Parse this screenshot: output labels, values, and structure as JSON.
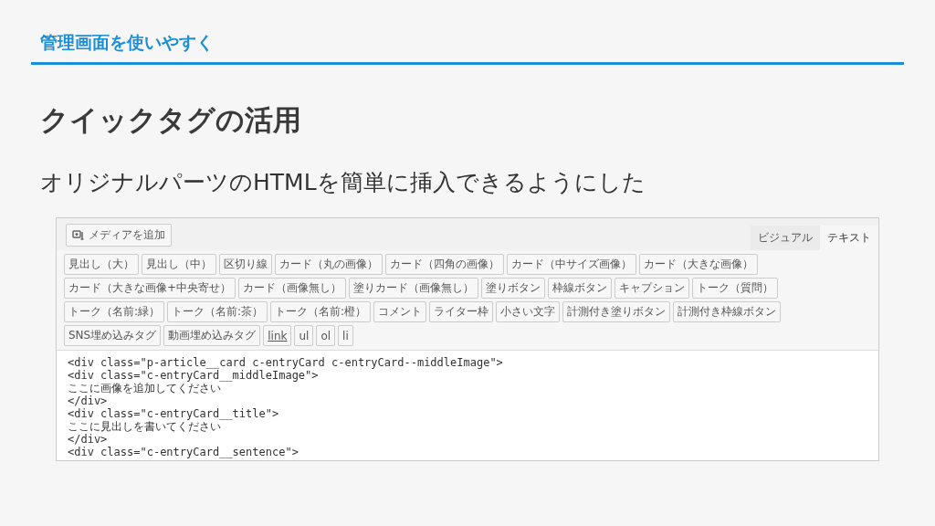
{
  "header": "管理画面を使いやすく",
  "title": "クイックタグの活用",
  "subtitle": "オリジナルパーツのHTMLを簡単に挿入できるようにした",
  "editor": {
    "media_button": "メディアを追加",
    "tabs": [
      {
        "label": "ビジュアル",
        "selected": false
      },
      {
        "label": "テキスト",
        "selected": true
      }
    ],
    "quicktags": [
      {
        "label": "見出し（大）",
        "kind": "tag"
      },
      {
        "label": "見出し（中）",
        "kind": "tag"
      },
      {
        "label": "区切り線",
        "kind": "tag"
      },
      {
        "label": "カード（丸の画像）",
        "kind": "tag"
      },
      {
        "label": "カード（四角の画像）",
        "kind": "tag"
      },
      {
        "label": "カード（中サイズ画像）",
        "kind": "tag"
      },
      {
        "label": "カード（大きな画像）",
        "kind": "tag"
      },
      {
        "label": "カード（大きな画像+中央寄せ）",
        "kind": "tag"
      },
      {
        "label": "カード（画像無し）",
        "kind": "tag"
      },
      {
        "label": "塗りカード（画像無し）",
        "kind": "tag"
      },
      {
        "label": "塗りボタン",
        "kind": "tag"
      },
      {
        "label": "枠線ボタン",
        "kind": "tag"
      },
      {
        "label": "キャプション",
        "kind": "tag"
      },
      {
        "label": "トーク（質問）",
        "kind": "tag"
      },
      {
        "label": "トーク（名前:緑）",
        "kind": "tag"
      },
      {
        "label": "トーク（名前:茶）",
        "kind": "tag"
      },
      {
        "label": "トーク（名前:橙）",
        "kind": "tag"
      },
      {
        "label": "コメント",
        "kind": "tag"
      },
      {
        "label": "ライター枠",
        "kind": "tag"
      },
      {
        "label": "小さい文字",
        "kind": "tag"
      },
      {
        "label": "計測付き塗りボタン",
        "kind": "tag"
      },
      {
        "label": "計測付き枠線ボタン",
        "kind": "tag"
      },
      {
        "label": "SNS埋め込みタグ",
        "kind": "tag"
      },
      {
        "label": "動画埋め込みタグ",
        "kind": "tag"
      },
      {
        "label": "link",
        "kind": "link"
      },
      {
        "label": "ul",
        "kind": "tag"
      },
      {
        "label": "ol",
        "kind": "tag"
      },
      {
        "label": "li",
        "kind": "tag"
      }
    ],
    "code_lines": [
      "<div class=\"p-article__card c-entryCard c-entryCard--middleImage\">",
      "<div class=\"c-entryCard__middleImage\">",
      "ここに画像を追加してください",
      "</div>",
      "<div class=\"c-entryCard__title\">",
      "ここに見出しを書いてください",
      "</div>",
      "<div class=\"c-entryCard__sentence\">"
    ]
  }
}
